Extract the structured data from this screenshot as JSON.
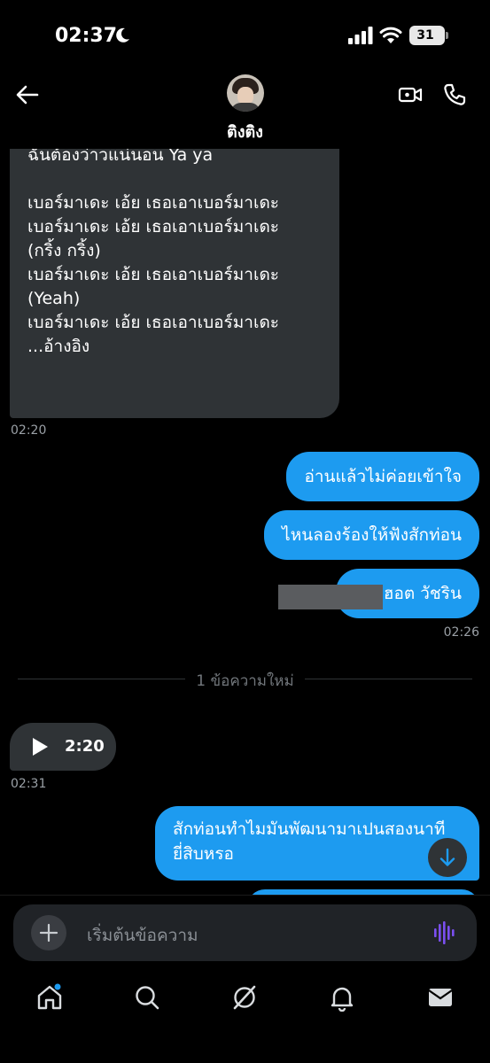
{
  "status_bar": {
    "time": "02:37",
    "battery": "31"
  },
  "header": {
    "contact_name": "ติงติง"
  },
  "messages": {
    "lyrics_lines_1": "จังหวะนี้ไม่กลัวเลยพ่อรึม\nต้องบุกตอนนี้ชะแล้วไม่งั้น\nฉันต้องว่าวแน่นอน Ya ya",
    "lyrics_lines_2": "เบอร์มาเดะ เอ้ย เธอเอาเบอร์มาเดะ\nเบอร์มาเดะ เอ้ย เธอเอาเบอร์มาเดะ\n(กริ้ง กริ้ง)\nเบอร์มาเดะ เอ้ย เธอเอาเบอร์มาเดะ\n(Yeah)\nเบอร์มาเดะ เอ้ย เธอเอาเบอร์มาเดะ\n...อ้างอิง",
    "lyrics_time": "02:20",
    "out_1": "อ่านแล้วไม่ค่อยเข้าใจ",
    "out_2": "ไหนลองร้องให้ฟังสักท่อน",
    "out_3": "ฮอต วัชริน",
    "out_time": "02:26",
    "divider": "1 ข้อความใหม่",
    "audio_duration": "2:20",
    "audio_time": "02:31",
    "out_4": "สักท่อนทำไมมันพัฒนามาเปนสองนาที\nยี่สิบหรอ"
  },
  "composer": {
    "placeholder": "เริ่มต้นข้อความ"
  },
  "icons": [
    "back-arrow-icon",
    "video-icon",
    "phone-icon",
    "plus-icon",
    "voice-wave-icon",
    "home-icon",
    "search-icon",
    "grok-icon",
    "bell-icon",
    "mail-icon",
    "arrow-down-icon",
    "play-icon"
  ],
  "colors": {
    "accent": "#1d9bf0",
    "incoming_bubble": "#2f3336",
    "voice_icon": "#7b4ff0"
  }
}
